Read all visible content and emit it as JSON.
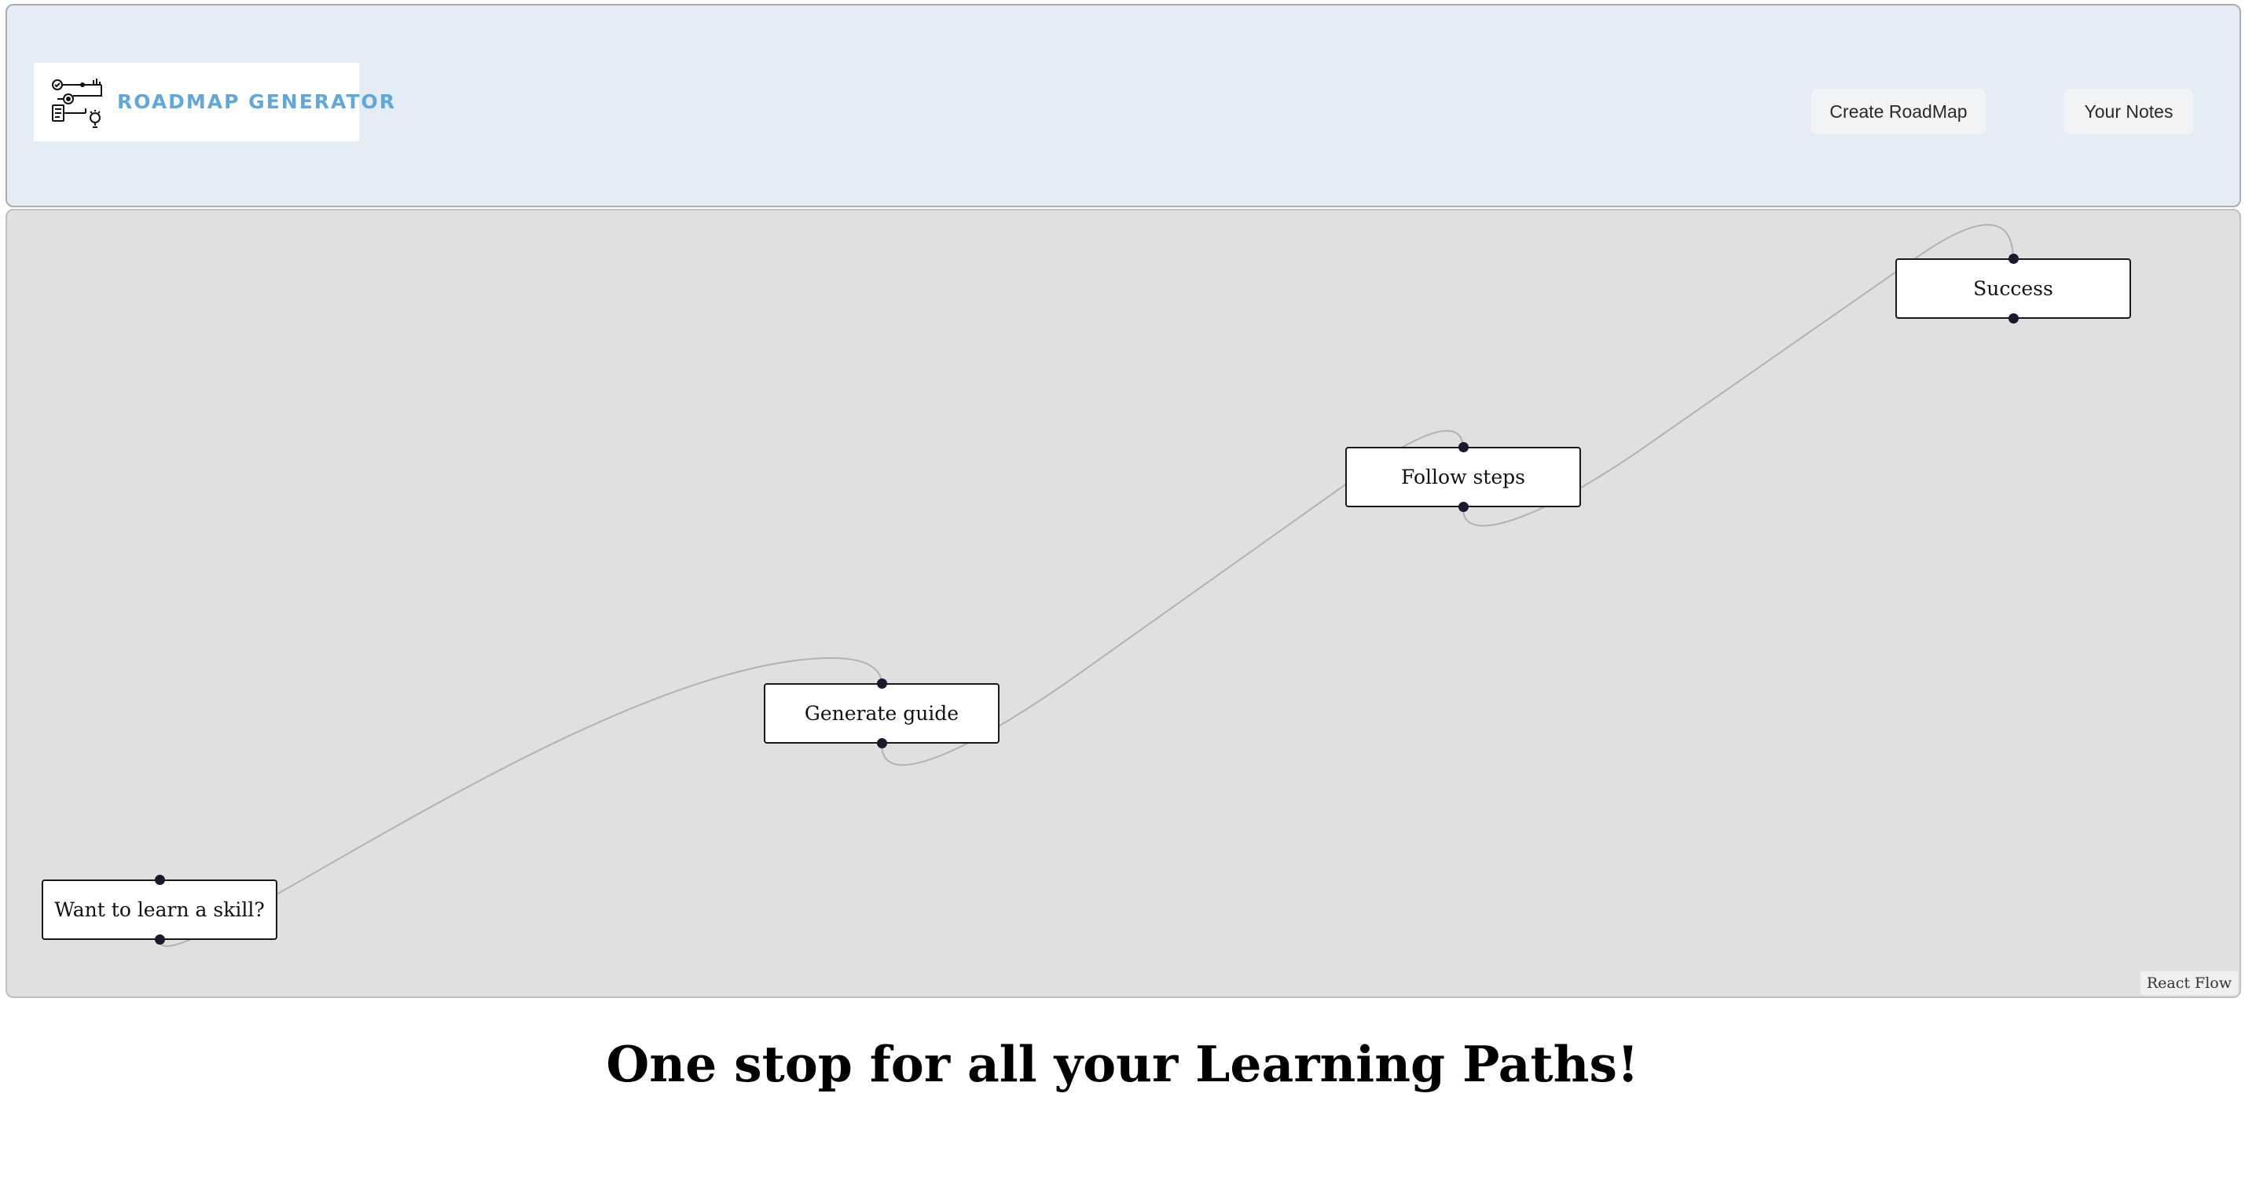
{
  "header": {
    "logo_text": "ROADMAP GENERATOR",
    "logo_icon": "roadmap-process-icon",
    "nav": {
      "create_label": "Create RoadMap",
      "notes_label": "Your Notes"
    }
  },
  "flow": {
    "nodes": [
      {
        "id": "n1",
        "label": "Want to learn a skill?"
      },
      {
        "id": "n2",
        "label": "Generate guide"
      },
      {
        "id": "n3",
        "label": "Follow steps"
      },
      {
        "id": "n4",
        "label": "Success"
      }
    ],
    "edges": [
      {
        "from": "n1",
        "to": "n2"
      },
      {
        "from": "n2",
        "to": "n3"
      },
      {
        "from": "n3",
        "to": "n4"
      }
    ],
    "attribution": "React Flow",
    "colors": {
      "canvas": "#e0e0e0",
      "edge": "#b1b1b7",
      "handle": "#1a1a2e"
    }
  },
  "tagline": "One stop for all your Learning Paths!",
  "colors": {
    "header_bg": "#e4ecf5",
    "logo_text": "#5fa8de"
  }
}
